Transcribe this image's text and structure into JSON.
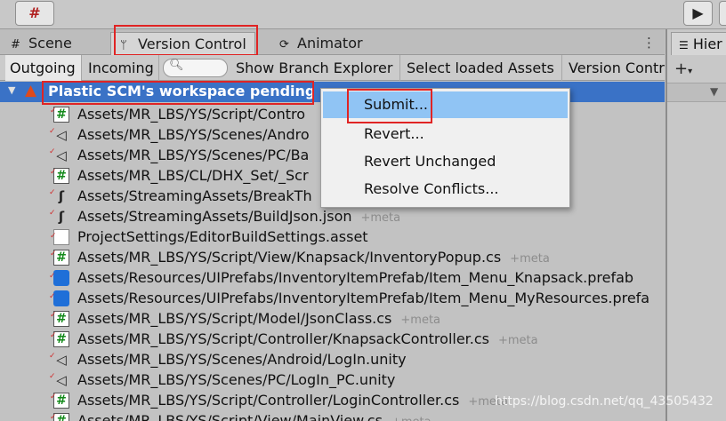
{
  "toolbar": {
    "grid_icon": "grid-snap-icon",
    "play_icon": "play-icon"
  },
  "tabs": {
    "scene": {
      "label": "Scene",
      "icon": "grid-icon"
    },
    "version_control": {
      "label": "Version Control",
      "icon": "branch-icon"
    },
    "animator": {
      "label": "Animator",
      "icon": "animator-icon"
    },
    "menu_icon": "kebab-menu-icon"
  },
  "hierarchy": {
    "label": "Hier",
    "add_icon": "plus-icon"
  },
  "subtoolbar": {
    "outgoing": "Outgoing",
    "incoming": "Incoming",
    "search_placeholder": "",
    "show_branch_explorer": "Show Branch Explorer",
    "select_loaded_assets": "Select loaded Assets",
    "version_control": "Version Contr"
  },
  "group": {
    "title": "Plastic SCM's workspace pending c"
  },
  "files": [
    {
      "name": "Assets/MR_LBS/YS/Script/Contro",
      "meta": "",
      "type": "cs"
    },
    {
      "name": "Assets/MR_LBS/YS/Scenes/Andro",
      "meta": "",
      "type": "unity"
    },
    {
      "name": "Assets/MR_LBS/YS/Scenes/PC/Ba",
      "meta": "",
      "type": "unity"
    },
    {
      "name": "Assets/MR_LBS/CL/DHX_Set/_Scr",
      "meta": "",
      "type": "cs"
    },
    {
      "name": "Assets/StreamingAssets/BreakTh",
      "meta": "",
      "type": "json"
    },
    {
      "name": "Assets/StreamingAssets/BuildJson.json",
      "meta": "+meta",
      "type": "json"
    },
    {
      "name": "ProjectSettings/EditorBuildSettings.asset",
      "meta": "",
      "type": "asset"
    },
    {
      "name": "Assets/MR_LBS/YS/Script/View/Knapsack/InventoryPopup.cs",
      "meta": "+meta",
      "type": "cs"
    },
    {
      "name": "Assets/Resources/UIPrefabs/InventoryItemPrefab/Item_Menu_Knapsack.prefab",
      "meta": "",
      "type": "prefab"
    },
    {
      "name": "Assets/Resources/UIPrefabs/InventoryItemPrefab/Item_Menu_MyResources.prefa",
      "meta": "",
      "type": "prefab"
    },
    {
      "name": "Assets/MR_LBS/YS/Script/Model/JsonClass.cs",
      "meta": "+meta",
      "type": "cs"
    },
    {
      "name": "Assets/MR_LBS/YS/Script/Controller/KnapsackController.cs",
      "meta": "+meta",
      "type": "cs"
    },
    {
      "name": "Assets/MR_LBS/YS/Scenes/Android/LogIn.unity",
      "meta": "",
      "type": "unity"
    },
    {
      "name": "Assets/MR_LBS/YS/Scenes/PC/LogIn_PC.unity",
      "meta": "",
      "type": "unity"
    },
    {
      "name": "Assets/MR_LBS/YS/Script/Controller/LoginController.cs",
      "meta": "+meta",
      "type": "cs"
    },
    {
      "name": "Assets/MR_LBS/YS/Script/View/MainView.cs",
      "meta": "+meta",
      "type": "cs"
    }
  ],
  "context_menu": {
    "items": [
      "Submit...",
      "Revert...",
      "Revert Unchanged",
      "Resolve Conflicts..."
    ]
  },
  "watermark": "https://blog.csdn.net/qq_43505432"
}
